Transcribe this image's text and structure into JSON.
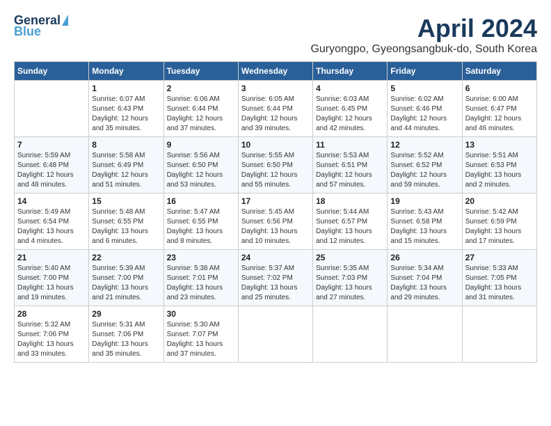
{
  "header": {
    "logo_general": "General",
    "logo_blue": "Blue",
    "title": "April 2024",
    "subtitle": "Guryongpo, Gyeongsangbuk-do, South Korea"
  },
  "days_of_week": [
    "Sunday",
    "Monday",
    "Tuesday",
    "Wednesday",
    "Thursday",
    "Friday",
    "Saturday"
  ],
  "weeks": [
    [
      {
        "day": "",
        "details": ""
      },
      {
        "day": "1",
        "details": "Sunrise: 6:07 AM\nSunset: 6:43 PM\nDaylight: 12 hours\nand 35 minutes."
      },
      {
        "day": "2",
        "details": "Sunrise: 6:06 AM\nSunset: 6:44 PM\nDaylight: 12 hours\nand 37 minutes."
      },
      {
        "day": "3",
        "details": "Sunrise: 6:05 AM\nSunset: 6:44 PM\nDaylight: 12 hours\nand 39 minutes."
      },
      {
        "day": "4",
        "details": "Sunrise: 6:03 AM\nSunset: 6:45 PM\nDaylight: 12 hours\nand 42 minutes."
      },
      {
        "day": "5",
        "details": "Sunrise: 6:02 AM\nSunset: 6:46 PM\nDaylight: 12 hours\nand 44 minutes."
      },
      {
        "day": "6",
        "details": "Sunrise: 6:00 AM\nSunset: 6:47 PM\nDaylight: 12 hours\nand 46 minutes."
      }
    ],
    [
      {
        "day": "7",
        "details": "Sunrise: 5:59 AM\nSunset: 6:48 PM\nDaylight: 12 hours\nand 48 minutes."
      },
      {
        "day": "8",
        "details": "Sunrise: 5:58 AM\nSunset: 6:49 PM\nDaylight: 12 hours\nand 51 minutes."
      },
      {
        "day": "9",
        "details": "Sunrise: 5:56 AM\nSunset: 6:50 PM\nDaylight: 12 hours\nand 53 minutes."
      },
      {
        "day": "10",
        "details": "Sunrise: 5:55 AM\nSunset: 6:50 PM\nDaylight: 12 hours\nand 55 minutes."
      },
      {
        "day": "11",
        "details": "Sunrise: 5:53 AM\nSunset: 6:51 PM\nDaylight: 12 hours\nand 57 minutes."
      },
      {
        "day": "12",
        "details": "Sunrise: 5:52 AM\nSunset: 6:52 PM\nDaylight: 12 hours\nand 59 minutes."
      },
      {
        "day": "13",
        "details": "Sunrise: 5:51 AM\nSunset: 6:53 PM\nDaylight: 13 hours\nand 2 minutes."
      }
    ],
    [
      {
        "day": "14",
        "details": "Sunrise: 5:49 AM\nSunset: 6:54 PM\nDaylight: 13 hours\nand 4 minutes."
      },
      {
        "day": "15",
        "details": "Sunrise: 5:48 AM\nSunset: 6:55 PM\nDaylight: 13 hours\nand 6 minutes."
      },
      {
        "day": "16",
        "details": "Sunrise: 5:47 AM\nSunset: 6:55 PM\nDaylight: 13 hours\nand 8 minutes."
      },
      {
        "day": "17",
        "details": "Sunrise: 5:45 AM\nSunset: 6:56 PM\nDaylight: 13 hours\nand 10 minutes."
      },
      {
        "day": "18",
        "details": "Sunrise: 5:44 AM\nSunset: 6:57 PM\nDaylight: 13 hours\nand 12 minutes."
      },
      {
        "day": "19",
        "details": "Sunrise: 5:43 AM\nSunset: 6:58 PM\nDaylight: 13 hours\nand 15 minutes."
      },
      {
        "day": "20",
        "details": "Sunrise: 5:42 AM\nSunset: 6:59 PM\nDaylight: 13 hours\nand 17 minutes."
      }
    ],
    [
      {
        "day": "21",
        "details": "Sunrise: 5:40 AM\nSunset: 7:00 PM\nDaylight: 13 hours\nand 19 minutes."
      },
      {
        "day": "22",
        "details": "Sunrise: 5:39 AM\nSunset: 7:00 PM\nDaylight: 13 hours\nand 21 minutes."
      },
      {
        "day": "23",
        "details": "Sunrise: 5:38 AM\nSunset: 7:01 PM\nDaylight: 13 hours\nand 23 minutes."
      },
      {
        "day": "24",
        "details": "Sunrise: 5:37 AM\nSunset: 7:02 PM\nDaylight: 13 hours\nand 25 minutes."
      },
      {
        "day": "25",
        "details": "Sunrise: 5:35 AM\nSunset: 7:03 PM\nDaylight: 13 hours\nand 27 minutes."
      },
      {
        "day": "26",
        "details": "Sunrise: 5:34 AM\nSunset: 7:04 PM\nDaylight: 13 hours\nand 29 minutes."
      },
      {
        "day": "27",
        "details": "Sunrise: 5:33 AM\nSunset: 7:05 PM\nDaylight: 13 hours\nand 31 minutes."
      }
    ],
    [
      {
        "day": "28",
        "details": "Sunrise: 5:32 AM\nSunset: 7:06 PM\nDaylight: 13 hours\nand 33 minutes."
      },
      {
        "day": "29",
        "details": "Sunrise: 5:31 AM\nSunset: 7:06 PM\nDaylight: 13 hours\nand 35 minutes."
      },
      {
        "day": "30",
        "details": "Sunrise: 5:30 AM\nSunset: 7:07 PM\nDaylight: 13 hours\nand 37 minutes."
      },
      {
        "day": "",
        "details": ""
      },
      {
        "day": "",
        "details": ""
      },
      {
        "day": "",
        "details": ""
      },
      {
        "day": "",
        "details": ""
      }
    ]
  ]
}
